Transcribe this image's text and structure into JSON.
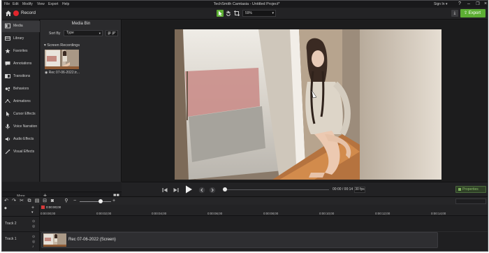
{
  "menu": [
    "File",
    "Edit",
    "Modify",
    "View",
    "Export",
    "Help"
  ],
  "app_title": "TechSmith Camtasia - Untitled Project*",
  "sign_in": "Sign In",
  "toolbar": {
    "record_label": "Record",
    "zoom_value": "59%",
    "export_label": "Export"
  },
  "sidebar": {
    "items": [
      {
        "label": "Media",
        "icon": "media-icon"
      },
      {
        "label": "Library",
        "icon": "library-icon"
      },
      {
        "label": "Favorites",
        "icon": "star-icon"
      },
      {
        "label": "Annotations",
        "icon": "annotation-icon"
      },
      {
        "label": "Transitions",
        "icon": "transition-icon"
      },
      {
        "label": "Behaviors",
        "icon": "behavior-icon"
      },
      {
        "label": "Animations",
        "icon": "animation-icon"
      },
      {
        "label": "Cursor Effects",
        "icon": "cursor-icon"
      },
      {
        "label": "Voice Narration",
        "icon": "microphone-icon"
      },
      {
        "label": "Audio Effects",
        "icon": "speaker-icon"
      },
      {
        "label": "Visual Effects",
        "icon": "wand-icon"
      }
    ],
    "more_label": "More"
  },
  "media_bin": {
    "title": "Media Bin",
    "sort_by_label": "Sort By",
    "sort_value": "Type",
    "group_header": "Screen Recordings",
    "thumb_label": "Rec 07-06-2022.tr..."
  },
  "playback": {
    "time": "00:00 / 00:14",
    "fps": "30 fps",
    "properties_label": "Properties"
  },
  "timeline": {
    "playhead_time": "0:00:00;00",
    "ticks": [
      "0:00:00;00",
      "0:00:02;00",
      "0:00:04;00",
      "0:00:06;00",
      "0:00:08;00",
      "0:00:10;00",
      "0:00:12;00",
      "0:00:14;00"
    ],
    "tracks": [
      "Track 2",
      "Track 1"
    ],
    "clip_label": "Rec 07-06-2022 (Screen)"
  },
  "colors": {
    "accent_green": "#5cae33",
    "record_red": "#e0262d",
    "panel_bg": "#2b2b2d",
    "canvas_bg": "#1c1c1d"
  }
}
